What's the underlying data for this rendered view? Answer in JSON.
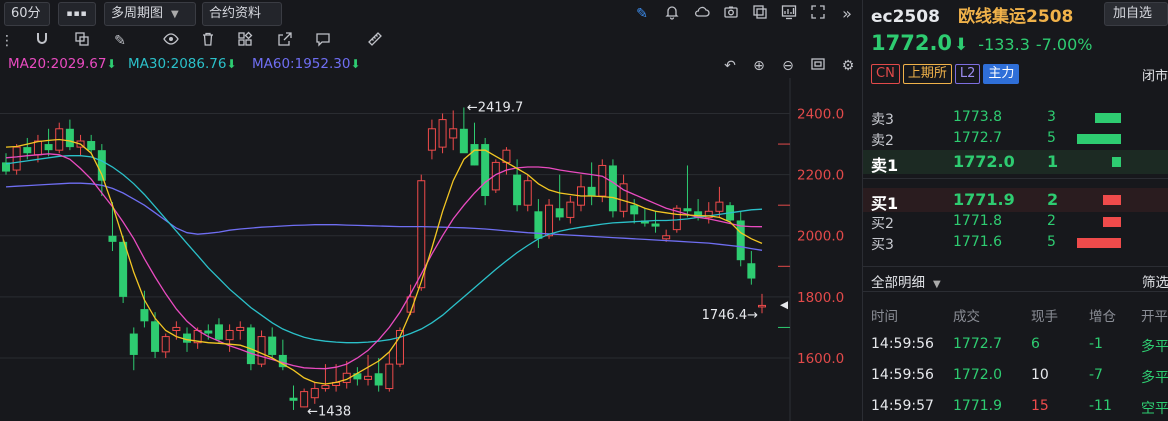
{
  "toolbar": {
    "period": "60分",
    "more_label": "▪▪▪",
    "multi_period": "多周期图",
    "contract_info": "合约资料"
  },
  "ma": {
    "ma20": "MA20:2029.67",
    "ma30": "MA30:2086.76",
    "ma60": "MA60:1952.30",
    "ma20_color": "#e94bc0",
    "ma30_color": "#2bc0c9",
    "ma60_color": "#6f6ef2"
  },
  "chart_data": {
    "type": "candlestick",
    "ylim": [
      1420,
      2490
    ],
    "y_ticks": [
      "2400.0",
      "2200.0",
      "2000.0",
      "1800.0",
      "1600.0"
    ],
    "y_tick_values": [
      2400,
      2200,
      2000,
      1800,
      1600
    ],
    "annotations": {
      "high_label": "←2419.7",
      "high_value": 2419.7,
      "low_label": "←1438",
      "low_value": 1438,
      "last_label": "1746.4→",
      "last_value": 1746.4
    },
    "up_color": "#ef4b4b",
    "down_color": "#2ecc71",
    "candles": [
      [
        2240,
        2270,
        2200,
        2210
      ],
      [
        2215,
        2300,
        2200,
        2290
      ],
      [
        2290,
        2320,
        2250,
        2270
      ],
      [
        2265,
        2330,
        2240,
        2310
      ],
      [
        2300,
        2350,
        2260,
        2280
      ],
      [
        2280,
        2370,
        2270,
        2350
      ],
      [
        2350,
        2380,
        2280,
        2290
      ],
      [
        2290,
        2330,
        2260,
        2310
      ],
      [
        2310,
        2330,
        2270,
        2280
      ],
      [
        2280,
        2300,
        2130,
        2180
      ],
      [
        2000,
        2110,
        1950,
        1980
      ],
      [
        1980,
        2000,
        1780,
        1800
      ],
      [
        1680,
        1700,
        1560,
        1610
      ],
      [
        1760,
        1820,
        1700,
        1720
      ],
      [
        1720,
        1750,
        1600,
        1620
      ],
      [
        1620,
        1680,
        1600,
        1670
      ],
      [
        1690,
        1720,
        1660,
        1700
      ],
      [
        1680,
        1700,
        1620,
        1650
      ],
      [
        1650,
        1700,
        1630,
        1690
      ],
      [
        1690,
        1710,
        1660,
        1680
      ],
      [
        1710,
        1730,
        1650,
        1660
      ],
      [
        1660,
        1710,
        1620,
        1690
      ],
      [
        1690,
        1720,
        1660,
        1700
      ],
      [
        1700,
        1710,
        1560,
        1580
      ],
      [
        1580,
        1690,
        1570,
        1670
      ],
      [
        1670,
        1700,
        1600,
        1610
      ],
      [
        1610,
        1660,
        1560,
        1570
      ],
      [
        1470,
        1510,
        1430,
        1460
      ],
      [
        1440,
        1500,
        1438,
        1490
      ],
      [
        1470,
        1520,
        1450,
        1500
      ],
      [
        1500,
        1580,
        1490,
        1510
      ],
      [
        1510,
        1580,
        1490,
        1520
      ],
      [
        1520,
        1590,
        1500,
        1550
      ],
      [
        1550,
        1570,
        1510,
        1530
      ],
      [
        1530,
        1610,
        1510,
        1540
      ],
      [
        1550,
        1600,
        1490,
        1510
      ],
      [
        1500,
        1620,
        1490,
        1580
      ],
      [
        1580,
        1700,
        1570,
        1690
      ],
      [
        1750,
        1840,
        1740,
        1800
      ],
      [
        1830,
        2200,
        1820,
        2180
      ],
      [
        2280,
        2380,
        2250,
        2350
      ],
      [
        2290,
        2400,
        2270,
        2380
      ],
      [
        2320,
        2410,
        2280,
        2350
      ],
      [
        2350,
        2419.7,
        2310,
        2270
      ],
      [
        2300,
        2370,
        2230,
        2230
      ],
      [
        2300,
        2320,
        2100,
        2130
      ],
      [
        2150,
        2250,
        2140,
        2240
      ],
      [
        2240,
        2290,
        2200,
        2280
      ],
      [
        2200,
        2250,
        2080,
        2100
      ],
      [
        2100,
        2200,
        2080,
        2180
      ],
      [
        2080,
        2120,
        1960,
        1990
      ],
      [
        2000,
        2120,
        1990,
        2100
      ],
      [
        2090,
        2200,
        2050,
        2060
      ],
      [
        2060,
        2130,
        2040,
        2110
      ],
      [
        2100,
        2200,
        2080,
        2160
      ],
      [
        2160,
        2240,
        2100,
        2130
      ],
      [
        2130,
        2250,
        2110,
        2230
      ],
      [
        2230,
        2250,
        2060,
        2080
      ],
      [
        2080,
        2200,
        2060,
        2170
      ],
      [
        2100,
        2120,
        2040,
        2070
      ],
      [
        2050,
        2090,
        2030,
        2040
      ],
      [
        2040,
        2080,
        2010,
        2030
      ],
      [
        1990,
        2020,
        1980,
        2000
      ],
      [
        2020,
        2100,
        2010,
        2090
      ],
      [
        2090,
        2230,
        2060,
        2080
      ],
      [
        2080,
        2120,
        2050,
        2060
      ],
      [
        2060,
        2110,
        2040,
        2080
      ],
      [
        2080,
        2160,
        2060,
        2110
      ],
      [
        2100,
        2110,
        2040,
        2050
      ],
      [
        2050,
        2080,
        1900,
        1920
      ],
      [
        1910,
        1950,
        1840,
        1860
      ],
      [
        1772,
        1810,
        1746.4,
        1772
      ]
    ],
    "ma20": [
      2255,
      2258,
      2262,
      2265,
      2268,
      2265,
      2250,
      2220,
      2185,
      2140,
      2095,
      2045,
      1990,
      1925,
      1865,
      1810,
      1760,
      1720,
      1690,
      1670,
      1655,
      1640,
      1628,
      1615,
      1605,
      1595,
      1585,
      1575,
      1568,
      1566,
      1565,
      1570,
      1580,
      1600,
      1625,
      1660,
      1700,
      1750,
      1810,
      1875,
      1940,
      2000,
      2055,
      2100,
      2140,
      2175,
      2200,
      2215,
      2222,
      2225,
      2225,
      2222,
      2215,
      2210,
      2205,
      2200,
      2195,
      2175,
      2150,
      2135,
      2120,
      2105,
      2090,
      2080,
      2070,
      2060,
      2055,
      2048,
      2040,
      2032,
      2030,
      2029.67
    ],
    "ma30": [
      2235,
      2240,
      2245,
      2250,
      2255,
      2260,
      2262,
      2262,
      2258,
      2245,
      2225,
      2200,
      2170,
      2135,
      2095,
      2055,
      2015,
      1975,
      1935,
      1895,
      1860,
      1825,
      1795,
      1765,
      1740,
      1715,
      1695,
      1680,
      1668,
      1660,
      1655,
      1652,
      1650,
      1650,
      1652,
      1655,
      1660,
      1668,
      1680,
      1695,
      1715,
      1740,
      1770,
      1800,
      1830,
      1860,
      1890,
      1918,
      1945,
      1968,
      1990,
      2005,
      2015,
      2022,
      2028,
      2033,
      2038,
      2042,
      2044,
      2046,
      2048,
      2050,
      2050,
      2052,
      2055,
      2060,
      2065,
      2070,
      2075,
      2080,
      2085,
      2086.76
    ],
    "ma60": [
      2160,
      2162,
      2164,
      2166,
      2168,
      2170,
      2172,
      2172,
      2170,
      2165,
      2155,
      2140,
      2120,
      2100,
      2075,
      2050,
      2025,
      2010,
      2005,
      2008,
      2012,
      2018,
      2022,
      2025,
      2028,
      2030,
      2032,
      2034,
      2035,
      2036,
      2036,
      2036,
      2035,
      2034,
      2033,
      2032,
      2031,
      2030,
      2030,
      2030,
      2029,
      2028,
      2027,
      2026,
      2024,
      2022,
      2019,
      2016,
      2013,
      2010,
      2008,
      2006,
      2004,
      2002,
      2000,
      1998,
      1996,
      1994,
      1992,
      1990,
      1988,
      1986,
      1984,
      1982,
      1980,
      1978,
      1976,
      1972,
      1968,
      1964,
      1958,
      1952.3
    ],
    "ma_fast": [
      2290,
      2292,
      2300,
      2308,
      2312,
      2315,
      2310,
      2300,
      2270,
      2200,
      2100,
      1990,
      1880,
      1790,
      1730,
      1690,
      1670,
      1660,
      1655,
      1650,
      1648,
      1645,
      1642,
      1630,
      1615,
      1600,
      1580,
      1560,
      1535,
      1520,
      1515,
      1520,
      1530,
      1550,
      1570,
      1590,
      1620,
      1670,
      1750,
      1850,
      1960,
      2080,
      2180,
      2250,
      2280,
      2280,
      2260,
      2240,
      2220,
      2200,
      2170,
      2150,
      2140,
      2135,
      2130,
      2130,
      2128,
      2125,
      2115,
      2105,
      2090,
      2080,
      2075,
      2070,
      2068,
      2066,
      2065,
      2060,
      2045,
      2010,
      1990,
      1975
    ]
  },
  "quote": {
    "code": "ec2508",
    "name": "欧线集运2508",
    "add_button": "加自选",
    "last": "1772.0",
    "arrow": "⬇",
    "change": "-133.3",
    "change_pct": "-7.00%",
    "tags": [
      "CN",
      "上期所",
      "L2",
      "主力"
    ],
    "status": "闭市"
  },
  "order_book": {
    "asks": [
      {
        "label": "卖3",
        "price": "1773.8",
        "vol": "3",
        "bar": 0.6
      },
      {
        "label": "卖2",
        "price": "1772.7",
        "vol": "5",
        "bar": 1.0
      },
      {
        "label": "卖1",
        "price": "1772.0",
        "vol": "1",
        "bar": 0.2
      }
    ],
    "bids": [
      {
        "label": "买1",
        "price": "1771.9",
        "vol": "2",
        "bar": 0.4
      },
      {
        "label": "买2",
        "price": "1771.8",
        "vol": "2",
        "bar": 0.4
      },
      {
        "label": "买3",
        "price": "1771.6",
        "vol": "5",
        "bar": 1.0
      }
    ]
  },
  "details": {
    "title": "全部明细",
    "filter": "筛选",
    "headers": [
      "时间",
      "成交",
      "现手",
      "增仓",
      "开平"
    ],
    "rows": [
      {
        "time": "14:59:56",
        "price": "1772.7",
        "qty": "6",
        "oi": "-1",
        "type": "多平",
        "price_color": "green",
        "qty_color": "green",
        "type_color": "green"
      },
      {
        "time": "14:59:56",
        "price": "1772.0",
        "qty": "10",
        "oi": "-7",
        "type": "多平",
        "price_color": "green",
        "qty_color": "white",
        "type_color": "green"
      },
      {
        "time": "14:59:57",
        "price": "1771.9",
        "qty": "15",
        "oi": "-11",
        "type": "空平",
        "price_color": "green",
        "qty_color": "red",
        "type_color": "green"
      }
    ]
  }
}
